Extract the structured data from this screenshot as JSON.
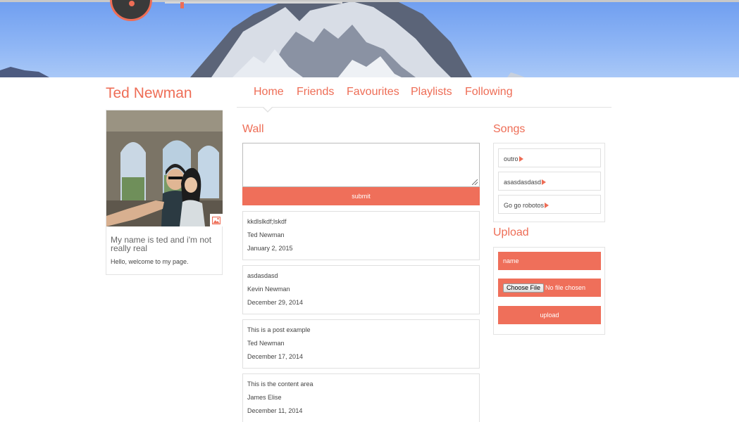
{
  "profile": {
    "name": "Ted Newman",
    "bio": "My name is ted and i'm not really real",
    "welcome": "Hello, welcome to my page."
  },
  "nav": {
    "items": [
      {
        "label": "Home"
      },
      {
        "label": "Friends"
      },
      {
        "label": "Favourites"
      },
      {
        "label": "Playlists"
      },
      {
        "label": "Following"
      }
    ]
  },
  "wall": {
    "title": "Wall",
    "input_value": "",
    "submit_label": "submit",
    "posts": [
      {
        "content": "kkdlslkdf;lskdf",
        "author": "Ted Newman",
        "date": "January 2, 2015"
      },
      {
        "content": "asdasdasd",
        "author": "Kevin Newman",
        "date": "December 29, 2014"
      },
      {
        "content": "This is a post example",
        "author": "Ted Newman",
        "date": "December 17, 2014"
      },
      {
        "content": "This is the content area",
        "author": "James Elise",
        "date": "December 11, 2014"
      }
    ]
  },
  "songs": {
    "title": "Songs",
    "items": [
      {
        "label": "outro"
      },
      {
        "label": "asasdasdasd"
      },
      {
        "label": "Go go robotos"
      }
    ]
  },
  "upload": {
    "title": "Upload",
    "name_placeholder": "name",
    "choose_file_label": "Choose File",
    "no_file_label": "No file chosen",
    "upload_label": "upload"
  },
  "colors": {
    "accent": "#ee6d56",
    "button": "#ef6f5a",
    "sky": "#7fa9f3"
  },
  "icons": {
    "logo": "vinyl-record-icon",
    "photo_button": "image-icon",
    "song_play": "play-icon",
    "textarea_resize": "resize-grip-icon"
  }
}
